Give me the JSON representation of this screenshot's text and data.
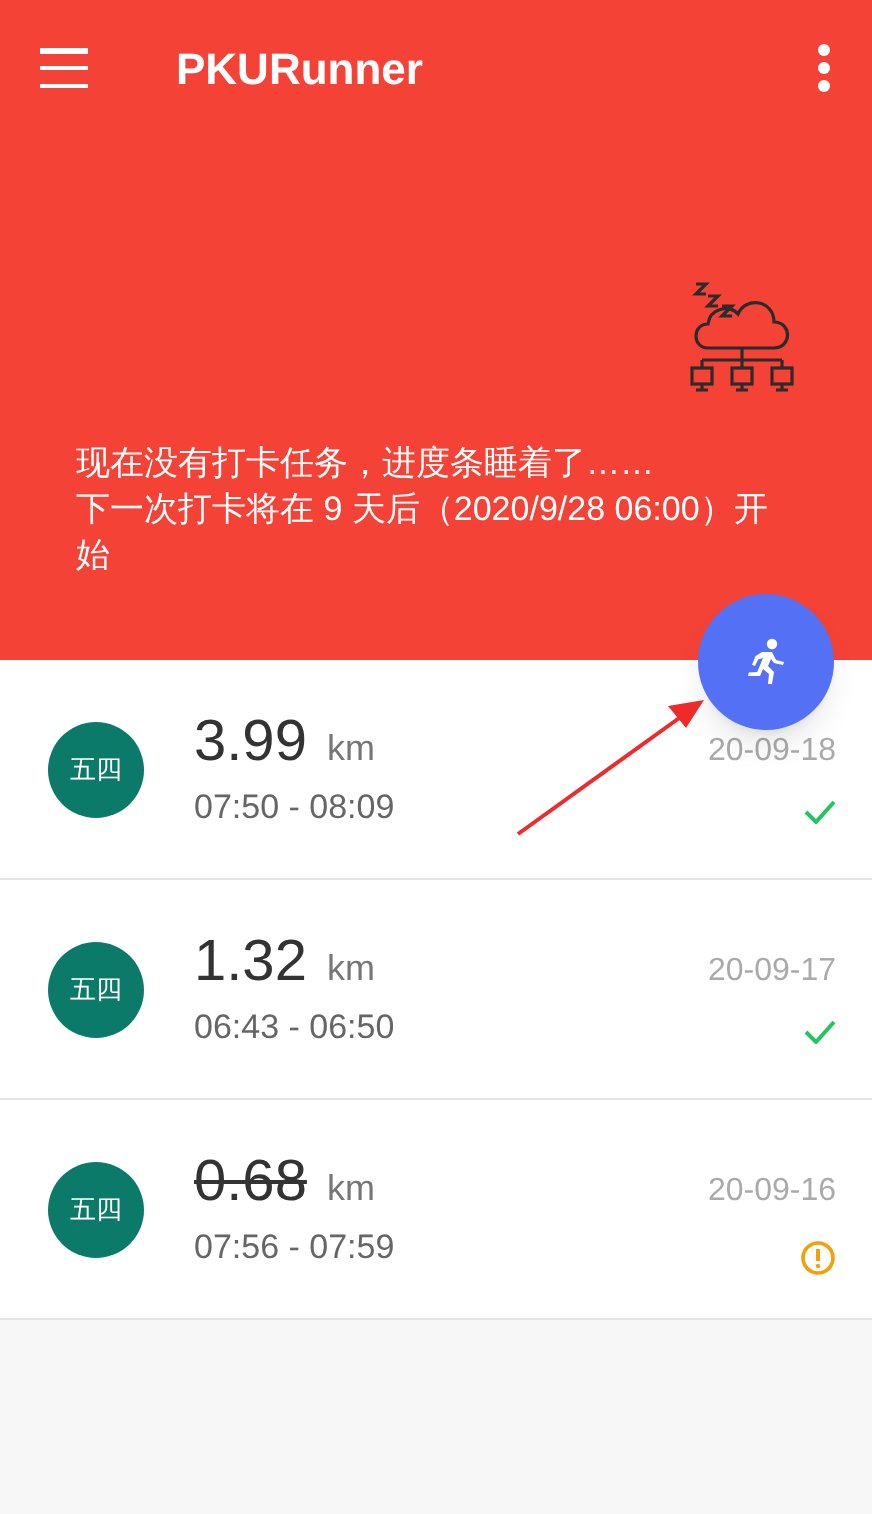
{
  "app_bar": {
    "title": "PKURunner"
  },
  "banner": {
    "message": "现在没有打卡任务，进度条睡着了……\n下一次打卡将在 9 天后（2020/9/28 06:00）开始"
  },
  "records": [
    {
      "badge": "五四",
      "distance": "3.99",
      "unit": "km",
      "time": "07:50 - 08:09",
      "date": "20-09-18",
      "valid": true
    },
    {
      "badge": "五四",
      "distance": "1.32",
      "unit": "km",
      "time": "06:43 - 06:50",
      "date": "20-09-17",
      "valid": true
    },
    {
      "badge": "五四",
      "distance": "0.68",
      "unit": "km",
      "time": "07:56 - 07:59",
      "date": "20-09-16",
      "valid": false
    }
  ]
}
